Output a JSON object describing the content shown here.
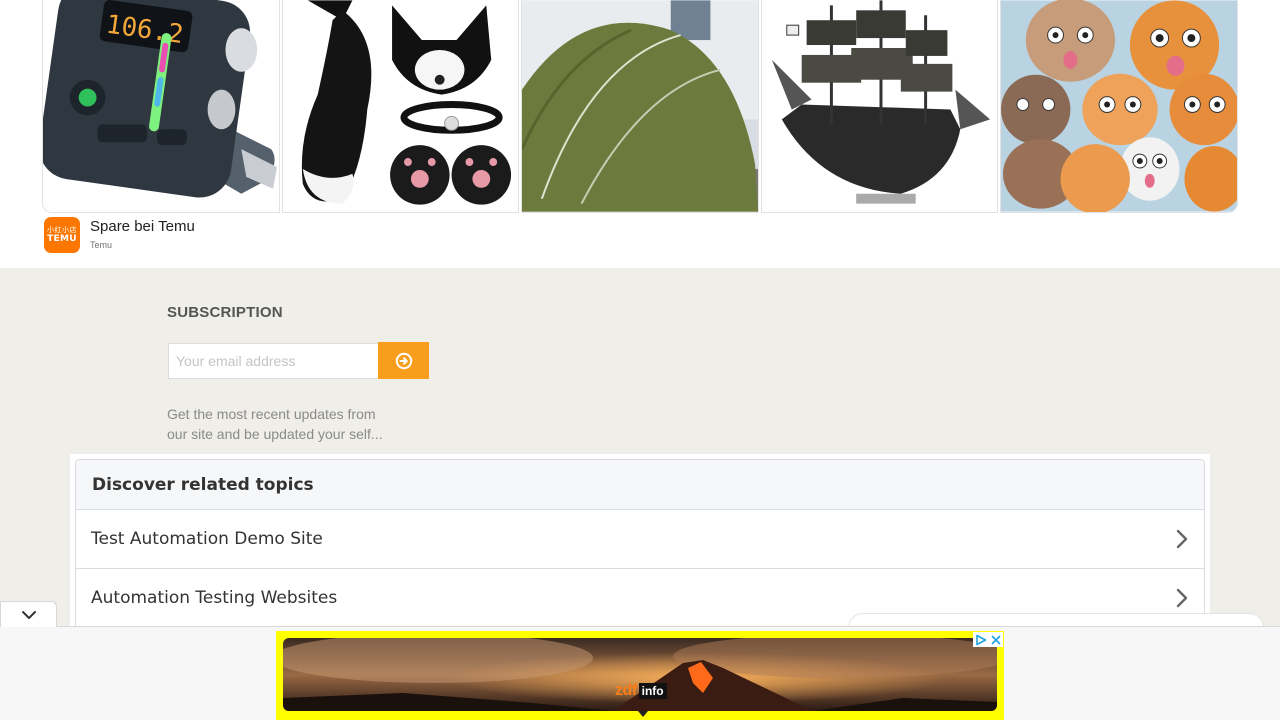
{
  "top_ad": {
    "advertiser_title": "Spare bei Temu",
    "advertiser_subtitle": "Temu",
    "logo_text": "TEMU",
    "logo_glyphs": "小红小店",
    "products": [
      {
        "name": "bluetooth-fm-transmitter",
        "display_text": "106.2"
      },
      {
        "name": "fox-costume-set"
      },
      {
        "name": "green-dome-tent"
      },
      {
        "name": "pirate-ship-model"
      },
      {
        "name": "funny-cats-picture"
      }
    ]
  },
  "subscription": {
    "title": "SUBSCRIPTION",
    "email_placeholder": "Your email address",
    "email_value": "",
    "description": "Get the most recent updates from our site and be updated your self..."
  },
  "related_topics": {
    "heading": "Discover related topics",
    "items": [
      {
        "label": "Test Automation Demo Site"
      },
      {
        "label": "Automation Testing Websites"
      }
    ]
  },
  "bottom_ad": {
    "brand_part1": "zdf",
    "brand_part2": "info"
  },
  "colors": {
    "accent_orange": "#f99d1c",
    "temu_orange": "#fb7701",
    "banner_yellow": "#ffff00",
    "page_bg": "#efeee8"
  }
}
